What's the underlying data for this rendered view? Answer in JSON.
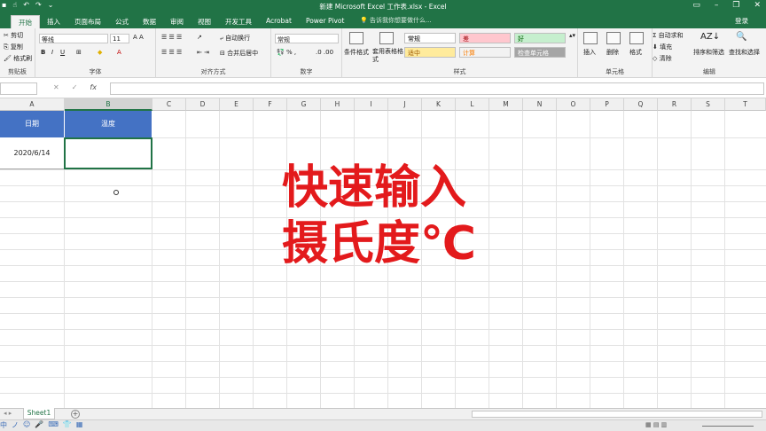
{
  "window": {
    "title": "新建 Microsoft Excel 工作表.xlsx - Excel",
    "login": "登录",
    "tell_me": "告诉我你想要做什么..."
  },
  "tabs": [
    "开始",
    "插入",
    "页面布局",
    "公式",
    "数据",
    "审阅",
    "视图",
    "开发工具",
    "Acrobat",
    "Power Pivot"
  ],
  "ribbon": {
    "clipboard": {
      "label": "剪贴板",
      "cut": "剪切",
      "copy": "复制",
      "format_painter": "格式刷"
    },
    "font": {
      "label": "字体",
      "font_name": "等线",
      "font_size": "11"
    },
    "alignment": {
      "label": "对齐方式",
      "wrap": "自动换行",
      "merge": "合并后居中"
    },
    "number": {
      "label": "数字",
      "format": "常规"
    },
    "styles": {
      "label": "样式",
      "conditional": "条件格式",
      "table_format": "套用表格格式",
      "cells": [
        {
          "text": "常规",
          "bg": "#ffffff",
          "fg": "#000000"
        },
        {
          "text": "差",
          "bg": "#ffc7ce",
          "fg": "#9c0006"
        },
        {
          "text": "好",
          "bg": "#c6efce",
          "fg": "#006100"
        },
        {
          "text": "适中",
          "bg": "#ffeb9c",
          "fg": "#9c5700"
        },
        {
          "text": "计算",
          "bg": "#f2f2f2",
          "fg": "#fa7d00"
        },
        {
          "text": "检查单元格",
          "bg": "#a5a5a5",
          "fg": "#ffffff"
        }
      ]
    },
    "cells": {
      "label": "单元格",
      "insert": "插入",
      "delete": "删除",
      "format": "格式"
    },
    "editing": {
      "label": "编辑",
      "autosum": "自动求和",
      "fill": "填充",
      "clear": "清除",
      "sort": "排序和筛选",
      "find": "查找和选择"
    }
  },
  "formula_bar": {
    "fx": "fx",
    "value": ""
  },
  "columns": [
    "A",
    "B",
    "C",
    "D",
    "E",
    "F",
    "G",
    "H",
    "I",
    "J",
    "K",
    "L",
    "M",
    "N",
    "O",
    "P",
    "Q",
    "R",
    "S",
    "T"
  ],
  "table": {
    "headers": [
      "日期",
      "温度"
    ],
    "row": [
      "2020/6/14",
      ""
    ]
  },
  "overlay": {
    "line1": "快速输入",
    "line2": "摄氏度℃"
  },
  "sheet": {
    "name": "Sheet1"
  },
  "colors": {
    "excel_green": "#217346",
    "header_blue": "#4472c4",
    "overlay_red": "#e31a1c"
  }
}
